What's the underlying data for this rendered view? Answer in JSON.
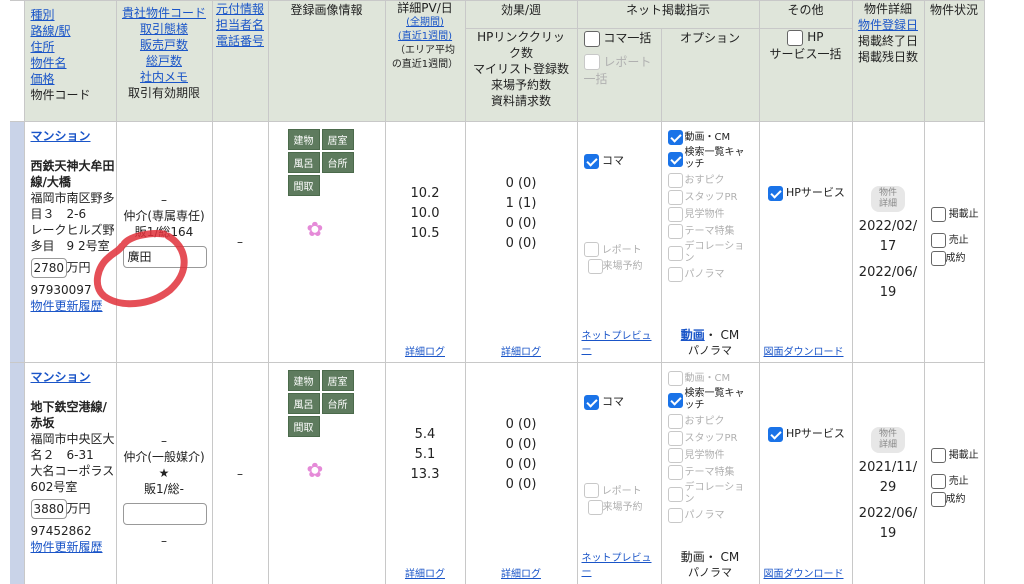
{
  "header": {
    "col1": [
      "種別",
      "路線/駅",
      "住所",
      "物件名",
      "価格"
    ],
    "col1_plain": "物件コード",
    "col2": [
      "貴社物件コード",
      "取引態様",
      "販売戸数",
      "総戸数",
      "社内メモ"
    ],
    "col2_plain": "取引有効期限",
    "col3": [
      "元付情報",
      "担当者名",
      "電話番号"
    ],
    "col4": "登録画像情報",
    "col5_title": "詳細PV/日",
    "col5_link1": "(全期間)",
    "col5_link2": "(直近1週間)",
    "col5_note1": "（エリア平均",
    "col5_note2": "の直近1週間）",
    "group_effect": "効果/週",
    "col6": [
      "HPリンククリッ",
      "ク数",
      "マイリスト登録数",
      "来場予約数",
      "資料請求数"
    ],
    "group_net": "ネット掲載指示",
    "col7_label1": "コマ一括",
    "col7_label2": "レポート一括",
    "col8": "オプション",
    "group_other": "その他",
    "col9": [
      "HP",
      "サービス一括"
    ],
    "col10_line1": "物件詳細",
    "col10_link": "物件登録日",
    "col10_line3": "掲載終了日",
    "col10_line4": "掲載残日数",
    "col11": "物件状況"
  },
  "rows": [
    {
      "type": "マンション",
      "station": "西鉄天神大牟田線/大橋",
      "address": "福岡市南区野多目３　2-6",
      "building": "レークヒルズ野多目　9 2号室",
      "price_value": "2780",
      "price_unit": "万円",
      "code": "97930097",
      "history_link": "物件更新履歴",
      "deal_dash": "–",
      "deal_type": "仲介(専属専任)",
      "units": "販1/総164",
      "memo": "廣田",
      "agent": "–",
      "tags": [
        "建物",
        "居室",
        "風呂",
        "台所",
        "間取"
      ],
      "pv": [
        "10.2",
        "10.0",
        "10.5"
      ],
      "pv_link": "詳細ログ",
      "effects": [
        "0 (0)",
        "1 (1)",
        "0 (0)",
        "0 (0)"
      ],
      "effects_link": "詳細ログ",
      "koma": "コマ",
      "report": "レポート",
      "reservation": "来場予約",
      "preview_link": "ネットプレビュー",
      "options": [
        {
          "label": "動画・CM",
          "on": true
        },
        {
          "label": "検索一覧キャッチ",
          "on": true
        },
        {
          "label": "おすピク",
          "on": false
        },
        {
          "label": "スタッフPR",
          "on": false
        },
        {
          "label": "見学物件",
          "on": false
        },
        {
          "label": "テーマ特集",
          "on": false
        },
        {
          "label": "デコレーション",
          "on": false
        },
        {
          "label": "パノラマ",
          "on": false
        }
      ],
      "option_summary_link": "動画",
      "option_summary_rest": "・ CM",
      "option_summary_line2": "パノラマ",
      "hp_service": "HPサービス",
      "floorplan_link": "図面ダウンロード",
      "detail_pill": "物件詳細",
      "reg_date": "2022/02/17",
      "end_date": "2022/06/19",
      "status": [
        "掲載止",
        "売止",
        "成約"
      ]
    },
    {
      "type": "マンション",
      "station": "地下鉄空港線/赤坂",
      "address": "福岡市中央区大名２　6-31",
      "building": "大名コーポラス　602号室",
      "price_value": "3880",
      "price_unit": "万円",
      "code": "97452862",
      "history_link": "物件更新履歴",
      "deal_dash": "–",
      "deal_type": "仲介(一般媒介)",
      "star": "★",
      "units": "販1/総-",
      "memo": "",
      "deal_dash2": "–",
      "agent": "–",
      "tags": [
        "建物",
        "居室",
        "風呂",
        "台所",
        "間取"
      ],
      "pv": [
        "5.4",
        "5.1",
        "13.3"
      ],
      "pv_link": "詳細ログ",
      "effects": [
        "0 (0)",
        "0 (0)",
        "0 (0)",
        "0 (0)"
      ],
      "effects_link": "詳細ログ",
      "koma": "コマ",
      "report": "レポート",
      "reservation": "来場予約",
      "preview_link": "ネットプレビュー",
      "options": [
        {
          "label": "動画・CM",
          "on": false
        },
        {
          "label": "検索一覧キャッチ",
          "on": true
        },
        {
          "label": "おすピク",
          "on": false
        },
        {
          "label": "スタッフPR",
          "on": false
        },
        {
          "label": "見学物件",
          "on": false
        },
        {
          "label": "テーマ特集",
          "on": false
        },
        {
          "label": "デコレーション",
          "on": false
        },
        {
          "label": "パノラマ",
          "on": false
        }
      ],
      "option_summary_line1": "動画・ CM",
      "option_summary_line2": "パノラマ",
      "hp_service": "HPサービス",
      "floorplan_link": "図面ダウンロード",
      "detail_pill": "物件詳細",
      "reg_date": "2021/11/29",
      "end_date": "2022/06/19",
      "status": [
        "掲載止",
        "売止",
        "成約"
      ]
    }
  ],
  "colors": {
    "header_bg": "#dfe5da",
    "link": "#1a55c8",
    "tag_bg": "#5e7b5e",
    "check": "#1a73e8",
    "annotation": "#e0303a"
  }
}
